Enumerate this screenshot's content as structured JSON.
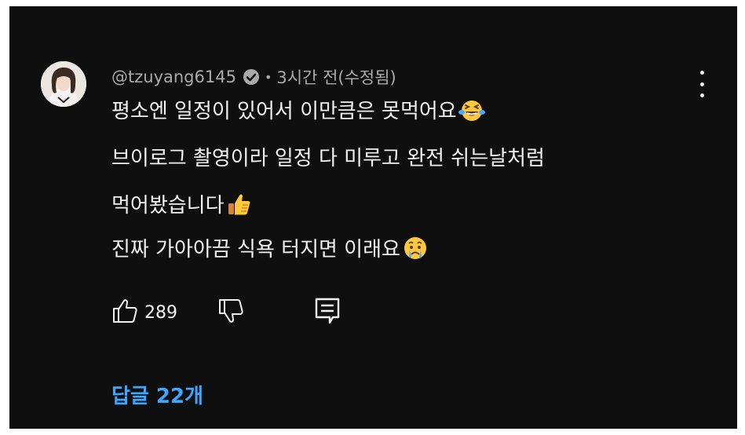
{
  "comment": {
    "author_handle": "@tzuyang6145",
    "separator": "•",
    "timestamp": "3시간 전(수정됨)",
    "verified_icon": "verified-check-icon",
    "more_icon": "vertical-dots-icon",
    "lines": [
      "평소엔 일정이 있어서 이만큼은 못먹어요",
      "브이로그 촬영이라 일정 다 미루고 완전 쉬는날처럼",
      "먹어봤습니다",
      "진짜 가아아끔 식욕 터지면 이래요"
    ],
    "emojis": [
      "laughing-tears-emoji",
      "thumbs-up-emoji",
      "crying-face-emoji"
    ]
  },
  "actions": {
    "like_icon": "thumbs-up-icon",
    "like_count": "289",
    "dislike_icon": "thumbs-down-icon",
    "reply_icon": "reply-comment-icon"
  },
  "replies": {
    "label": "답글 22개"
  },
  "colors": {
    "background": "#0f0f0f",
    "text": "#f1f1f1",
    "secondary_text": "#aaaaaa",
    "link": "#3ea6ff"
  }
}
